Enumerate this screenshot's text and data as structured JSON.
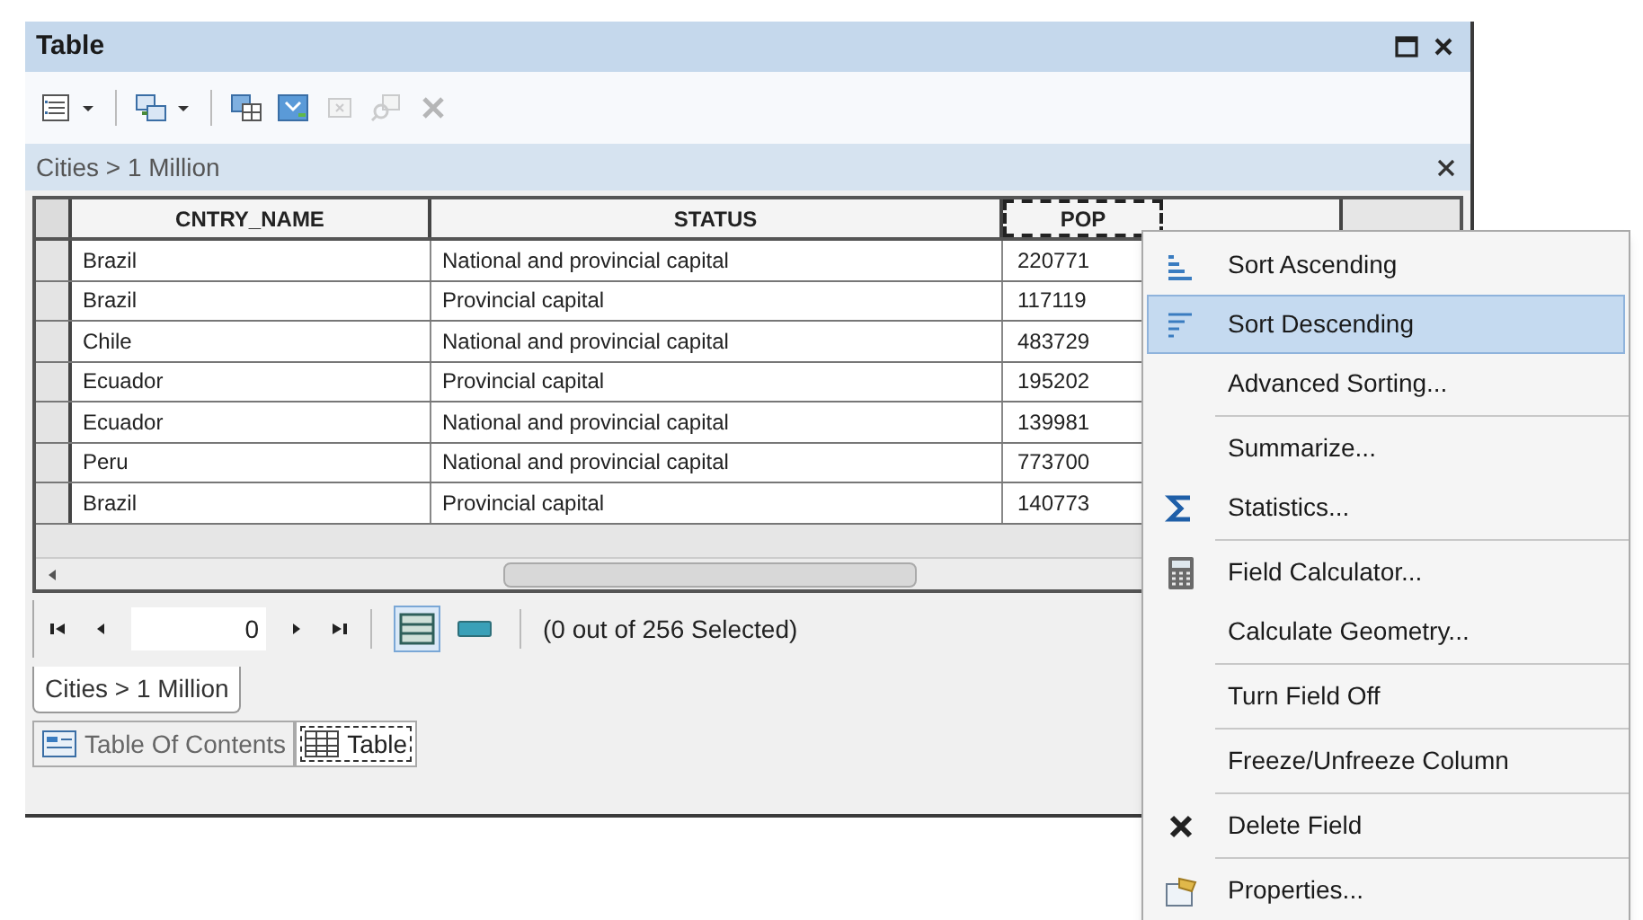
{
  "window": {
    "title": "Table"
  },
  "toolbar": {
    "buttons": [
      {
        "kind": "table-options",
        "dropdown": true,
        "disabled": false
      },
      {
        "kind": "related",
        "dropdown": true,
        "disabled": false
      },
      {
        "kind": "select-by-attributes",
        "dropdown": false,
        "disabled": false
      },
      {
        "kind": "switch-selection",
        "dropdown": false,
        "disabled": false
      },
      {
        "kind": "clear-selection",
        "dropdown": false,
        "disabled": true
      },
      {
        "kind": "zoom-selected",
        "dropdown": false,
        "disabled": true
      },
      {
        "kind": "delete-selected",
        "dropdown": false,
        "disabled": true
      }
    ]
  },
  "layer_bar": {
    "title": "Cities > 1 Million"
  },
  "table": {
    "columns": [
      {
        "label": "CNTRY_NAME",
        "selected": false
      },
      {
        "label": "STATUS",
        "selected": false
      },
      {
        "label": "POP",
        "selected": true
      }
    ],
    "rows": [
      {
        "cells": [
          "Brazil",
          "National and provincial capital",
          "220771"
        ]
      },
      {
        "cells": [
          "Brazil",
          "Provincial capital",
          "117119"
        ]
      },
      {
        "cells": [
          "Chile",
          "National and provincial capital",
          "483729"
        ]
      },
      {
        "cells": [
          "Ecuador",
          "Provincial capital",
          "195202"
        ]
      },
      {
        "cells": [
          "Ecuador",
          "National and provincial capital",
          "139981"
        ]
      },
      {
        "cells": [
          "Peru",
          "National and provincial capital",
          "773700"
        ]
      },
      {
        "cells": [
          "Brazil",
          "Provincial capital",
          "140773"
        ]
      }
    ]
  },
  "navigation": {
    "record": "0",
    "selection_text": "(0 out of 256 Selected)",
    "views": [
      {
        "kind": "all",
        "selected": true
      },
      {
        "kind": "selected",
        "selected": false
      }
    ]
  },
  "layer_tabs": [
    {
      "label": "Cities > 1 Million",
      "selected": true
    }
  ],
  "bottom_tabs": [
    {
      "label": "Table Of Contents",
      "kind": "toc",
      "selected": false
    },
    {
      "label": "Table",
      "kind": "table",
      "selected": true
    }
  ],
  "context_menu": {
    "items": [
      {
        "label": "Sort Ascending",
        "kind": "sort-asc",
        "selected": false,
        "separator_before": false
      },
      {
        "label": "Sort Descending",
        "kind": "sort-desc",
        "selected": true,
        "separator_before": false
      },
      {
        "label": "Advanced Sorting...",
        "kind": "plain",
        "selected": false,
        "separator_before": false
      },
      {
        "label": "Summarize...",
        "kind": "plain",
        "selected": false,
        "separator_before": true
      },
      {
        "label": "Statistics...",
        "kind": "sigma",
        "selected": false,
        "separator_before": false
      },
      {
        "label": "Field Calculator...",
        "kind": "calculator",
        "selected": false,
        "separator_before": true
      },
      {
        "label": "Calculate Geometry...",
        "kind": "plain",
        "selected": false,
        "separator_before": false
      },
      {
        "label": "Turn Field Off",
        "kind": "plain",
        "selected": false,
        "separator_before": true
      },
      {
        "label": "Freeze/Unfreeze Column",
        "kind": "plain",
        "selected": false,
        "separator_before": true
      },
      {
        "label": "Delete Field",
        "kind": "delete",
        "selected": false,
        "separator_before": true
      },
      {
        "label": "Properties...",
        "kind": "properties",
        "selected": false,
        "separator_before": true
      }
    ]
  }
}
